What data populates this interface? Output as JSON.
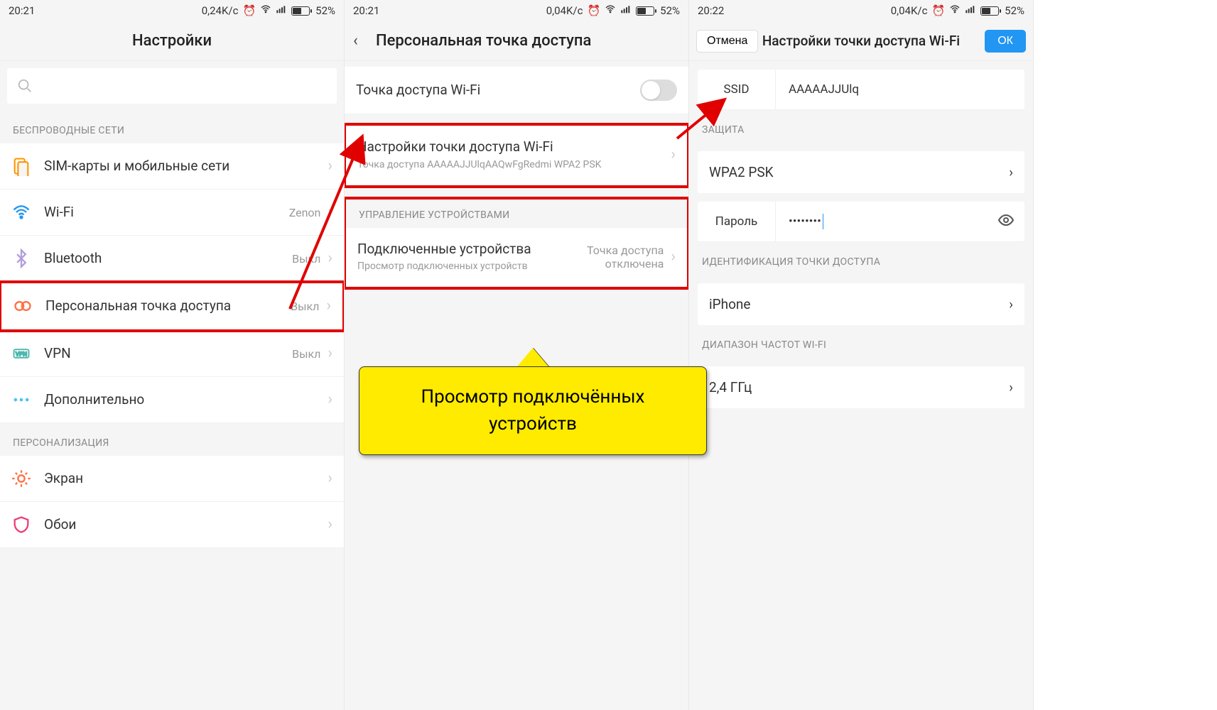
{
  "status": {
    "speed1": "0,24K/c",
    "speed2": "0,04K/c",
    "speed3": "0,04K/c",
    "time1": "20:21",
    "time2": "20:21",
    "time3": "20:22",
    "battery": "52%"
  },
  "screen1": {
    "title": "Настройки",
    "sect_wireless": "БЕСПРОВОДНЫЕ СЕТИ",
    "sect_personal": "ПЕРСОНАЛИЗАЦИЯ",
    "items": {
      "sim": "SIM-карты и мобильные сети",
      "wifi": "Wi-Fi",
      "wifi_val": "Zenon",
      "bt": "Bluetooth",
      "bt_val": "Выкл",
      "hotspot": "Персональная точка доступа",
      "hotspot_val": "Выкл",
      "vpn": "VPN",
      "vpn_val": "Выкл",
      "more": "Дополнительно",
      "screen": "Экран",
      "wallpaper": "Обои"
    }
  },
  "screen2": {
    "title": "Персональная точка доступа",
    "wifi_ap": "Точка доступа Wi-Fi",
    "ap_settings": "Настройки точки доступа Wi-Fi",
    "ap_settings_sub": "Точка доступа AAAAAJJUlqAAQwFgRedmi WPA2 PSK",
    "sect_devices": "УПРАВЛЕНИЕ УСТРОЙСТВАМИ",
    "connected": "Подключенные устройства",
    "connected_sub": "Просмотр подключенных устройств",
    "connected_val": "Точка доступа отключена"
  },
  "screen3": {
    "title": "Настройки точки доступа Wi-Fi",
    "cancel": "Отмена",
    "ok": "ОК",
    "ssid_label": "SSID",
    "ssid_value": "AAAAAJJUlq",
    "sect_security": "ЗАЩИТА",
    "security": "WPA2 PSK",
    "pwd_label": "Пароль",
    "pwd_value": "••••••••",
    "sect_id": "ИДЕНТИФИКАЦИЯ ТОЧКИ ДОСТУПА",
    "id_value": "iPhone",
    "sect_band": "ДИАПАЗОН ЧАСТОТ WI-FI",
    "band": "2,4 ГГц"
  },
  "callout": "Просмотр подключённых устройств"
}
